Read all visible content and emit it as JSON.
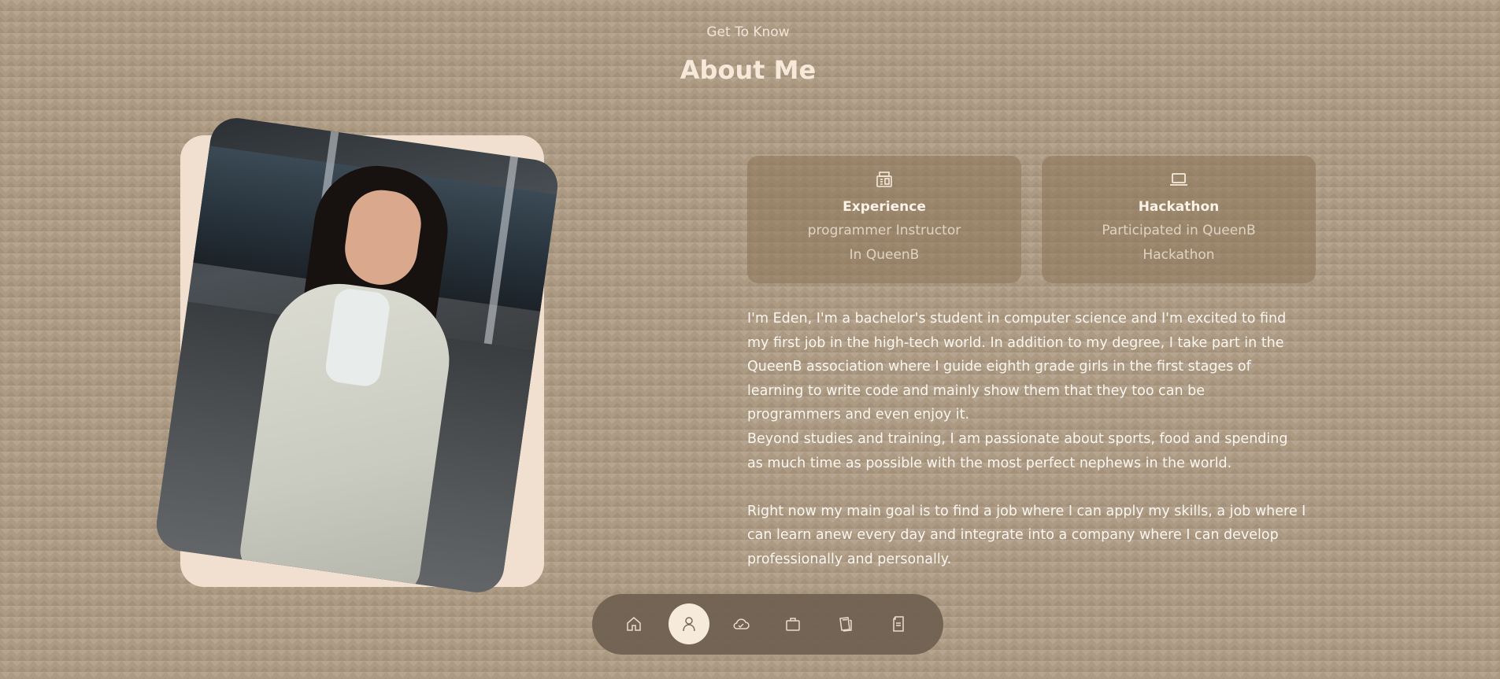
{
  "header": {
    "subtitle": "Get To Know",
    "title": "About Me"
  },
  "cards": [
    {
      "icon": "award-icon",
      "title": "Experience",
      "line1": "programmer Instructor",
      "line2": "In QueenB"
    },
    {
      "icon": "laptop-icon",
      "title": "Hackathon",
      "line1": "Participated in QueenB",
      "line2": "Hackathon"
    }
  ],
  "bio": {
    "line1": "I'm Eden, I'm a bachelor's student in computer science and I'm excited to find",
    "line2": "my first job in the high-tech world. In addition to my degree, I take part in the",
    "line3": "QueenB association where I guide eighth grade girls in the first stages of",
    "line4": "learning to write code and mainly show them that they too can be",
    "line5": "programmers and even enjoy it.",
    "line6": "Beyond studies and training, I am passionate about sports, food and spending",
    "line7": "as much time as possible with the most perfect nephews in the world.",
    "line8": "Right now my main goal is to find a job where I can apply my skills, a job where I",
    "line9": "can learn anew every day and integrate into a company where I can develop",
    "line10": "professionally and personally."
  },
  "nav": {
    "items": [
      "home-icon",
      "user-icon",
      "cloud-icon",
      "briefcase-icon",
      "book-icon",
      "document-icon"
    ],
    "active": "user-icon"
  },
  "colors": {
    "background": "#ad9a83",
    "accent": "#f6eadb",
    "card": "#8b7458",
    "navbar": "#6e6050"
  }
}
